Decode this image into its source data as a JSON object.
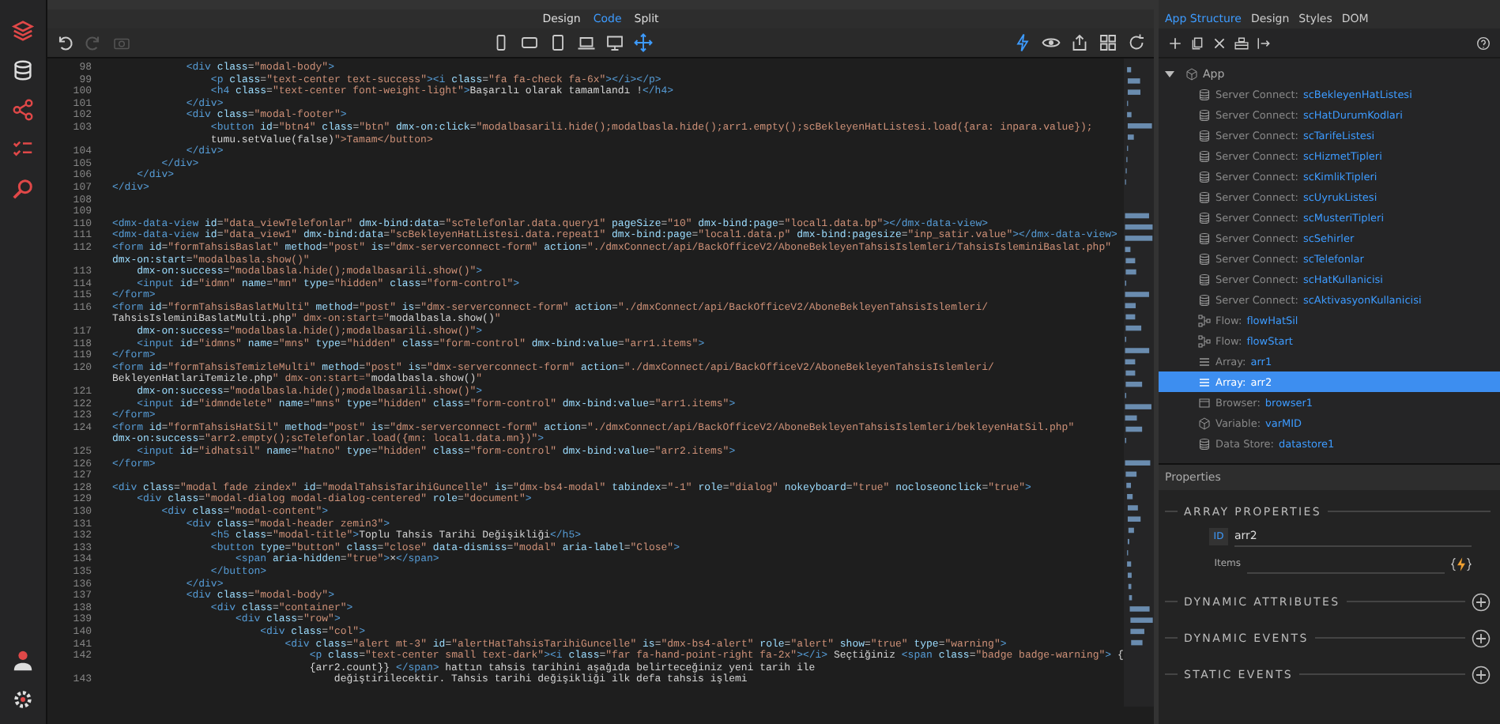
{
  "view_modes": [
    {
      "label": "Design",
      "selected": false
    },
    {
      "label": "Code",
      "selected": true
    },
    {
      "label": "Split",
      "selected": false
    }
  ],
  "editor_tools": [
    {
      "kind": "undo",
      "disabled": false
    },
    {
      "kind": "redo",
      "disabled": true
    },
    {
      "kind": "camera",
      "disabled": true
    }
  ],
  "device_tools": [
    {
      "kind": "phone",
      "selected": false
    },
    {
      "kind": "tablet-wide",
      "selected": false
    },
    {
      "kind": "tablet",
      "selected": false
    },
    {
      "kind": "laptop",
      "selected": false
    },
    {
      "kind": "desktop",
      "selected": false
    },
    {
      "kind": "move",
      "selected": true
    }
  ],
  "view_tools": [
    {
      "kind": "lightning",
      "selected": true
    },
    {
      "kind": "eye",
      "selected": false
    },
    {
      "kind": "share",
      "selected": false
    },
    {
      "kind": "grid",
      "selected": false
    },
    {
      "kind": "refresh",
      "selected": false
    }
  ],
  "editor": {
    "lines": [
      {
        "number": "98",
        "text": "            <div class=\"modal-body\">"
      },
      {
        "number": "99",
        "text": "                <p class=\"text-center text-success\"><i class=\"fa fa-check fa-6x\"></i></p>"
      },
      {
        "number": "100",
        "text": "                <h4 class=\"text-center font-weight-light\">Başarılı olarak tamamlandı !</h4>"
      },
      {
        "number": "101",
        "text": "            </div>"
      },
      {
        "number": "102",
        "text": "            <div class=\"modal-footer\">"
      },
      {
        "number": "103",
        "text": "                <button id=\"btn4\" class=\"btn\" dmx-on:click=\"modalbasarili.hide();modalbasla.hide();arr1.empty();scBekleyenHatListesi.load({ara: inpara.value});"
      },
      {
        "text": "                tumu.setValue(false)\">Tamam</button>"
      },
      {
        "number": "104",
        "text": "            </div>"
      },
      {
        "number": "105",
        "text": "        </div>"
      },
      {
        "number": "106",
        "text": "    </div>"
      },
      {
        "number": "107",
        "text": "</div>"
      },
      {
        "number": "108"
      },
      {
        "number": "109"
      },
      {
        "number": "110",
        "text": "<dmx-data-view id=\"data_viewTelefonlar\" dmx-bind:data=\"scTelefonlar.data.query1\" pageSize=\"10\" dmx-bind:page=\"local1.data.bp\"></dmx-data-view>"
      },
      {
        "number": "111",
        "text": "<dmx-data-view id=\"data_view1\" dmx-bind:data=\"scBekleyenHatListesi.data.repeat1\" dmx-bind:page=\"local1.data.p\" dmx-bind:pagesize=\"inp_satir.value\"></dmx-data-view>"
      },
      {
        "number": "112",
        "text": "<form id=\"formTahsisBaslat\" method=\"post\" is=\"dmx-serverconnect-form\" action=\"./dmxConnect/api/BackOfficeV2/AboneBekleyenTahsisIslemleri/TahsisIsleminiBaslat.php\""
      },
      {
        "text": "dmx-on:start=\"modalbasla.show()\""
      },
      {
        "number": "113",
        "text": "    dmx-on:success=\"modalbasla.hide();modalbasarili.show()\">"
      },
      {
        "number": "114",
        "text": "    <input id=\"idmn\" name=\"mn\" type=\"hidden\" class=\"form-control\">"
      },
      {
        "number": "115",
        "text": "</form>"
      },
      {
        "number": "116",
        "text": "<form id=\"formTahsisBaslatMulti\" method=\"post\" is=\"dmx-serverconnect-form\" action=\"./dmxConnect/api/BackOfficeV2/AboneBekleyenTahsisIslemleri/"
      },
      {
        "text": "TahsisIsleminiBaslatMulti.php\" dmx-on:start=\"modalbasla.show()\""
      },
      {
        "number": "117",
        "text": "    dmx-on:success=\"modalbasla.hide();modalbasarili.show()\">"
      },
      {
        "number": "118",
        "text": "    <input id=\"idmns\" name=\"mns\" type=\"hidden\" class=\"form-control\" dmx-bind:value=\"arr1.items\">"
      },
      {
        "number": "119",
        "text": "</form>"
      },
      {
        "number": "120",
        "text": "<form id=\"formTahsisTemizleMulti\" method=\"post\" is=\"dmx-serverconnect-form\" action=\"./dmxConnect/api/BackOfficeV2/AboneBekleyenTahsisIslemleri/"
      },
      {
        "text": "BekleyenHatlariTemizle.php\" dmx-on:start=\"modalbasla.show()\""
      },
      {
        "number": "121",
        "text": "    dmx-on:success=\"modalbasla.hide();modalbasarili.show()\">"
      },
      {
        "number": "122",
        "text": "    <input id=\"idmndelete\" name=\"mns\" type=\"hidden\" class=\"form-control\" dmx-bind:value=\"arr1.items\">"
      },
      {
        "number": "123",
        "text": "</form>"
      },
      {
        "number": "124",
        "text": "<form id=\"formTahsisHatSil\" method=\"post\" is=\"dmx-serverconnect-form\" action=\"./dmxConnect/api/BackOfficeV2/AboneBekleyenTahsisIslemleri/bekleyenHatSil.php\""
      },
      {
        "text": "dmx-on:success=\"arr2.empty();scTelefonlar.load({mn: local1.data.mn})\">"
      },
      {
        "number": "125",
        "text": "    <input id=\"idhatsil\" name=\"hatno\" type=\"hidden\" class=\"form-control\" dmx-bind:value=\"arr2.items\">"
      },
      {
        "number": "126",
        "text": "</form>"
      },
      {
        "number": "127"
      },
      {
        "number": "128",
        "text": "<div class=\"modal fade zindex\" id=\"modalTahsisTarihiGuncelle\" is=\"dmx-bs4-modal\" tabindex=\"-1\" role=\"dialog\" nokeyboard=\"true\" nocloseonclick=\"true\">"
      },
      {
        "number": "129",
        "text": "    <div class=\"modal-dialog modal-dialog-centered\" role=\"document\">"
      },
      {
        "number": "130",
        "text": "        <div class=\"modal-content\">"
      },
      {
        "number": "131",
        "text": "            <div class=\"modal-header zemin3\">"
      },
      {
        "number": "132",
        "text": "                <h5 class=\"modal-title\">Toplu Tahsis Tarihi Değişikliği</h5>"
      },
      {
        "number": "133",
        "text": "                <button type=\"button\" class=\"close\" data-dismiss=\"modal\" aria-label=\"Close\">"
      },
      {
        "number": "134",
        "text": "                    <span aria-hidden=\"true\">×</span>"
      },
      {
        "number": "135",
        "text": "                </button>"
      },
      {
        "number": "136",
        "text": "            </div>"
      },
      {
        "number": "137",
        "text": "            <div class=\"modal-body\">"
      },
      {
        "number": "138",
        "text": "                <div class=\"container\">"
      },
      {
        "number": "139",
        "text": "                    <div class=\"row\">"
      },
      {
        "number": "140",
        "text": "                        <div class=\"col\">"
      },
      {
        "number": "141",
        "text": "                            <div class=\"alert mt-3\" id=\"alertHatTahsisTarihiGuncelle\" is=\"dmx-bs4-alert\" role=\"alert\" show=\"true\" type=\"warning\">"
      },
      {
        "number": "142",
        "text": "                                <p class=\"text-center small text-dark\"><i class=\"far fa-hand-point-right fa-2x\"></i> Seçtiğiniz <span class=\"badge badge-warning\"> {"
      },
      {
        "text": "                                {arr2.count}} </span> hattın tahsis tarihini aşağıda belirteceğiniz yeni tarih ile"
      },
      {
        "number": "143",
        "text": "                                    değiştirilecektir. Tahsis tarihi değişikliği ilk defa tahsis işlemi"
      }
    ]
  },
  "panel_tabs": [
    {
      "label": "App Structure",
      "selected": true
    },
    {
      "label": "Design",
      "selected": false
    },
    {
      "label": "Styles",
      "selected": false
    },
    {
      "label": "DOM",
      "selected": false
    }
  ],
  "structure": {
    "label": "App",
    "expanded": true,
    "children": [
      {
        "kind": "server-connect",
        "type": "Server Connect:",
        "name": "scBekleyenHatListesi",
        "selected": false
      },
      {
        "kind": "server-connect",
        "type": "Server Connect:",
        "name": "scHatDurumKodlari",
        "selected": false
      },
      {
        "kind": "server-connect",
        "type": "Server Connect:",
        "name": "scTarifeListesi",
        "selected": false
      },
      {
        "kind": "server-connect",
        "type": "Server Connect:",
        "name": "scHizmetTipleri",
        "selected": false
      },
      {
        "kind": "server-connect",
        "type": "Server Connect:",
        "name": "scKimlikTipleri",
        "selected": false
      },
      {
        "kind": "server-connect",
        "type": "Server Connect:",
        "name": "scUyrukListesi",
        "selected": false
      },
      {
        "kind": "server-connect",
        "type": "Server Connect:",
        "name": "scMusteriTipleri",
        "selected": false
      },
      {
        "kind": "server-connect",
        "type": "Server Connect:",
        "name": "scSehirler",
        "selected": false
      },
      {
        "kind": "server-connect",
        "type": "Server Connect:",
        "name": "scTelefonlar",
        "selected": false
      },
      {
        "kind": "server-connect",
        "type": "Server Connect:",
        "name": "scHatKullanicisi",
        "selected": false
      },
      {
        "kind": "server-connect",
        "type": "Server Connect:",
        "name": "scAktivasyonKullanicisi",
        "selected": false
      },
      {
        "kind": "flow",
        "type": "Flow:",
        "name": "flowHatSil",
        "selected": false
      },
      {
        "kind": "flow",
        "type": "Flow:",
        "name": "flowStart",
        "selected": false
      },
      {
        "kind": "array",
        "type": "Array:",
        "name": "arr1",
        "selected": false
      },
      {
        "kind": "array",
        "type": "Array:",
        "name": "arr2",
        "selected": true
      },
      {
        "kind": "browser",
        "type": "Browser:",
        "name": "browser1",
        "selected": false
      },
      {
        "kind": "variable",
        "type": "Variable:",
        "name": "varMID",
        "selected": false
      },
      {
        "kind": "datastore",
        "type": "Data Store:",
        "name": "datastore1",
        "selected": false
      }
    ]
  },
  "properties": {
    "title": "Properties",
    "sections": [
      {
        "title": "ARRAY PROPERTIES",
        "fields": [
          {
            "label": "ID",
            "value": "arr2"
          },
          {
            "label": "Items",
            "dynamic": true
          }
        ]
      },
      {
        "title": "DYNAMIC ATTRIBUTES",
        "addable": true
      },
      {
        "title": "DYNAMIC EVENTS",
        "addable": true
      },
      {
        "title": "STATIC EVENTS",
        "addable": true
      }
    ]
  }
}
